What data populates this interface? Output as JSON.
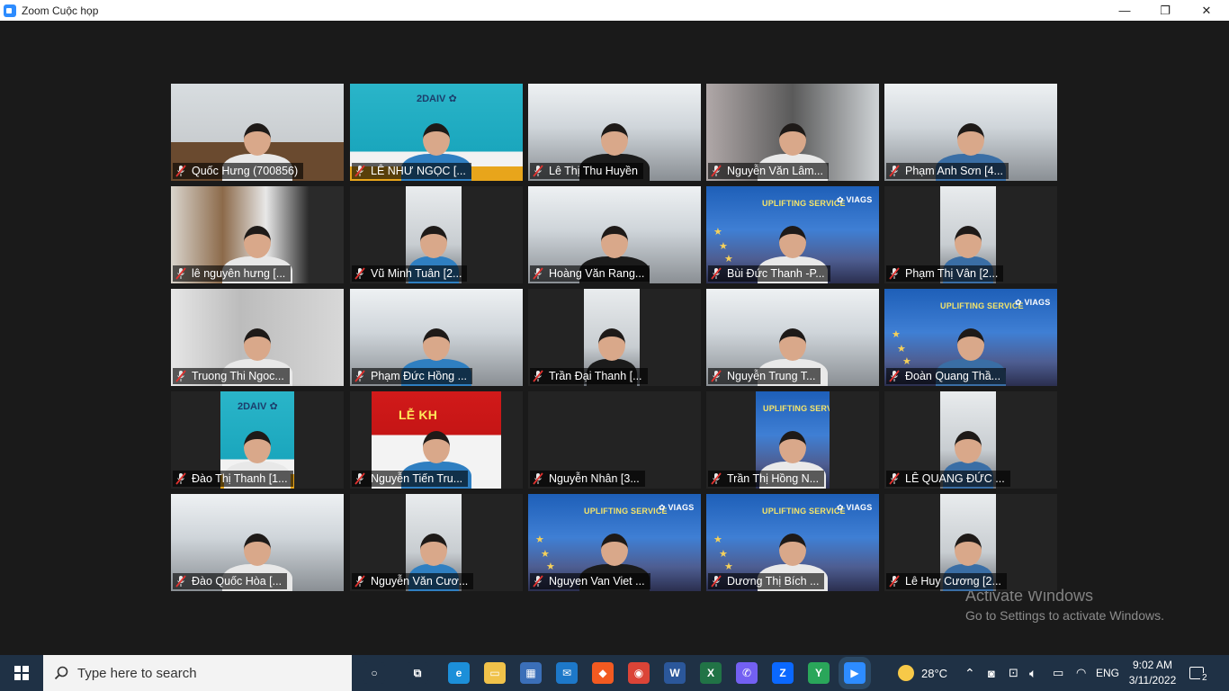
{
  "window": {
    "title": "Zoom Cuộc họp",
    "minimize": "—",
    "restore": "❐",
    "close": "✕"
  },
  "participants": [
    {
      "name": "Quốc Hưng (700856)",
      "active": true,
      "bg": "room"
    },
    {
      "name": "LÊ NHƯ NGỌC [...",
      "bg": "viags"
    },
    {
      "name": "Lê Thị Thu Huyền",
      "bg": "office"
    },
    {
      "name": "Nguyễn Văn Lâm...",
      "bg": "office-dark"
    },
    {
      "name": "Phạm Anh Sơn [4...",
      "bg": "office"
    },
    {
      "name": "lê nguyên hưng [...",
      "bg": "stairs"
    },
    {
      "name": "Vũ Minh Tuân [2...",
      "bg": "narrow"
    },
    {
      "name": "Hoàng Văn Rang...",
      "bg": "office"
    },
    {
      "name": "Bùi Đức Thanh -P...",
      "bg": "uplift"
    },
    {
      "name": "Phạm Thị Vân  [2...",
      "bg": "narrow"
    },
    {
      "name": "Truong Thi Ngoc...",
      "bg": "blur"
    },
    {
      "name": "Phạm Đức Hồng ...",
      "bg": "office"
    },
    {
      "name": "Trần Đại Thanh [...",
      "bg": "narrow"
    },
    {
      "name": "Nguyễn Trung T...",
      "bg": "office"
    },
    {
      "name": "Đoàn Quang Thầ...",
      "bg": "uplift"
    },
    {
      "name": "Đào Thị Thanh [1...",
      "bg": "viags-narrow"
    },
    {
      "name": "Nguyễn Tiến Tru...",
      "bg": "red-banner"
    },
    {
      "name": "Nguyễn Nhân [3...",
      "bg": "none"
    },
    {
      "name": "Trần Thị Hồng N...",
      "bg": "uplift-narrow"
    },
    {
      "name": "LÊ QUANG ĐỨC ...",
      "bg": "narrow"
    },
    {
      "name": "Đào Quốc Hòa [...",
      "bg": "office"
    },
    {
      "name": "Nguyễn Văn Cươ...",
      "bg": "narrow"
    },
    {
      "name": "Nguyen Van Viet ...",
      "bg": "uplift"
    },
    {
      "name": "Dương Thị Bích ...",
      "bg": "uplift"
    },
    {
      "name": "Lê Huy Cương [2...",
      "bg": "narrow"
    }
  ],
  "banners": {
    "uplift": "UPLIFTING SERVICE",
    "viags": "VIAGS",
    "viags_mirrored": "2DAIV",
    "red": "LỄ KH"
  },
  "watermark": {
    "line1": "Activate Windows",
    "line2": "Go to Settings to activate Windows."
  },
  "taskbar": {
    "search_placeholder": "Type here to search",
    "weather": "28°C",
    "language": "ENG",
    "time": "9:02 AM",
    "date": "3/11/2022",
    "notifications": "2",
    "apps": [
      {
        "name": "cortana-icon",
        "color": "#1f3145",
        "glyph": "○"
      },
      {
        "name": "task-view-icon",
        "color": "#1f3145",
        "glyph": "⧉"
      },
      {
        "name": "edge-icon",
        "color": "#1c8fd9",
        "glyph": "e"
      },
      {
        "name": "file-explorer-icon",
        "color": "#f0c24a",
        "glyph": "▭"
      },
      {
        "name": "store-icon",
        "color": "#3b6fb8",
        "glyph": "▦"
      },
      {
        "name": "mail-icon",
        "color": "#1d78c9",
        "glyph": "✉"
      },
      {
        "name": "brave-icon",
        "color": "#f25a21",
        "glyph": "◆"
      },
      {
        "name": "chrome-icon",
        "color": "#db4437",
        "glyph": "◉"
      },
      {
        "name": "word-icon",
        "color": "#2b579a",
        "glyph": "W"
      },
      {
        "name": "excel-icon",
        "color": "#217346",
        "glyph": "X"
      },
      {
        "name": "viber-icon",
        "color": "#7360f2",
        "glyph": "✆"
      },
      {
        "name": "zalo-icon",
        "color": "#0a68ff",
        "glyph": "Z"
      },
      {
        "name": "vpn-icon",
        "color": "#2aa65a",
        "glyph": "Y"
      },
      {
        "name": "zoom-icon",
        "color": "#2d8cff",
        "glyph": "▶"
      }
    ]
  }
}
